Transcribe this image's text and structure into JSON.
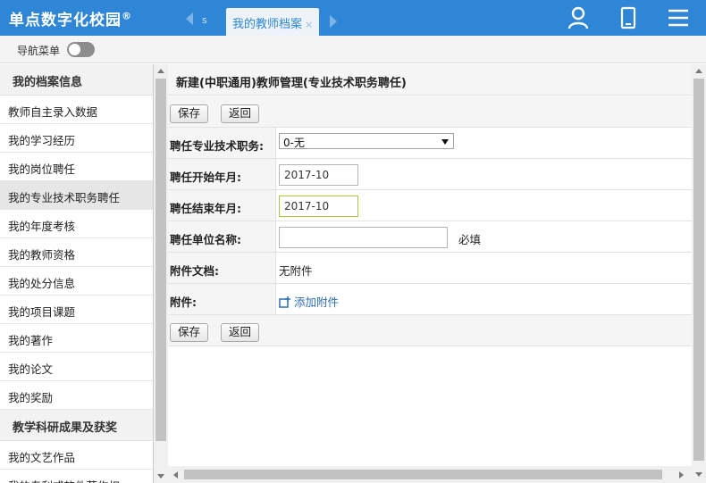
{
  "header": {
    "brand": "单点数字化校园",
    "brand_mark": "®",
    "tab_stub_label": "s",
    "active_tab": "我的教师档案",
    "tab_close": "×",
    "icons": [
      "user-icon",
      "mobile-icon",
      "menu-icon"
    ]
  },
  "navrow": {
    "label": "导航菜单",
    "toggle_on": false
  },
  "sidebar": {
    "sections": [
      {
        "title": "我的档案信息"
      },
      {
        "title": "教学科研成果及获奖"
      }
    ],
    "items_group1": [
      "教师自主录入数据",
      "我的学习经历",
      "我的岗位聘任",
      "我的专业技术职务聘任",
      "我的年度考核",
      "我的教师资格",
      "我的处分信息",
      "我的项目课题",
      "我的著作",
      "我的论文",
      "我的奖励"
    ],
    "items_group2": [
      "我的文艺作品",
      "我的专利或软件著作权"
    ],
    "active_item": "我的专业技术职务聘任"
  },
  "form": {
    "title": "新建(中职通用)教师管理(专业技术职务聘任)",
    "save_label": "保存",
    "back_label": "返回",
    "fields": {
      "position": {
        "label": "聘任专业技术职务:",
        "selected": "0-无"
      },
      "start": {
        "label": "聘任开始年月:",
        "value": "2017-10"
      },
      "end": {
        "label": "聘任结束年月:",
        "value": "2017-10"
      },
      "unit": {
        "label": "聘任单位名称:",
        "value": "",
        "required_note": "必填"
      },
      "docs": {
        "label": "附件文档:",
        "value": "无附件"
      },
      "attach": {
        "label": "附件:",
        "link": "添加附件"
      }
    }
  },
  "colors": {
    "header_bg": "#2f86d6",
    "link": "#2d6db5",
    "focus_border": "#a9c83a"
  }
}
